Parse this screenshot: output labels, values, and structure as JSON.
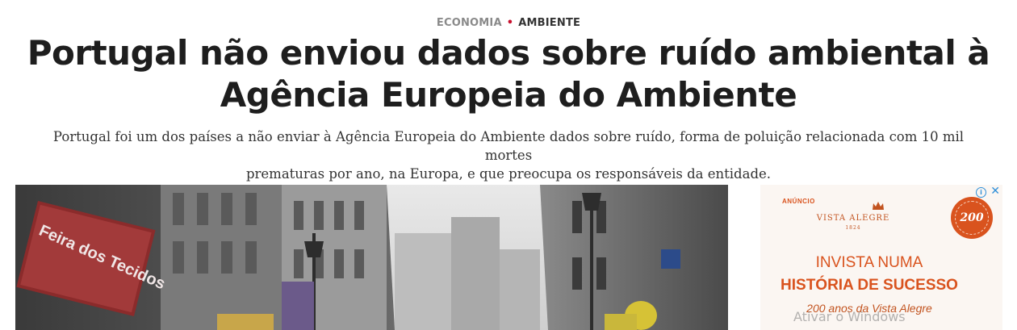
{
  "article": {
    "categories": [
      "ECONOMIA",
      "AMBIENTE"
    ],
    "category_separator": "•",
    "headline_line1": "Portugal não enviou dados sobre ruído ambiental à",
    "headline_line2": "Agência Europeia do Ambiente",
    "lead_line1": "Portugal foi um dos países a não enviar à Agência Europeia do Ambiente dados sobre ruído, forma de poluição relacionada com 10 mil mortes",
    "lead_line2": "prematuras por ano, na Europa, e que preocupa os responsáveis da entidade.",
    "photo_sign_text": "Feira dos Tecidos"
  },
  "ad": {
    "label": "ANÚNCIO",
    "brand": "VISTA ALEGRE",
    "brand_year": "1824",
    "badge_text": "200",
    "headline_1": "INVISTA NUMA",
    "headline_2": "HISTÓRIA DE SUCESSO",
    "subtitle": "200 anos da Vista Alegre",
    "info_icon": "ⓘ",
    "close_icon": "✕",
    "accent_color": "#d9531e"
  },
  "system": {
    "watermark": "Ativar o Windows"
  },
  "colors": {
    "category_separator": "#c8102e",
    "headline": "#1e1e1e",
    "lead": "#333333"
  }
}
